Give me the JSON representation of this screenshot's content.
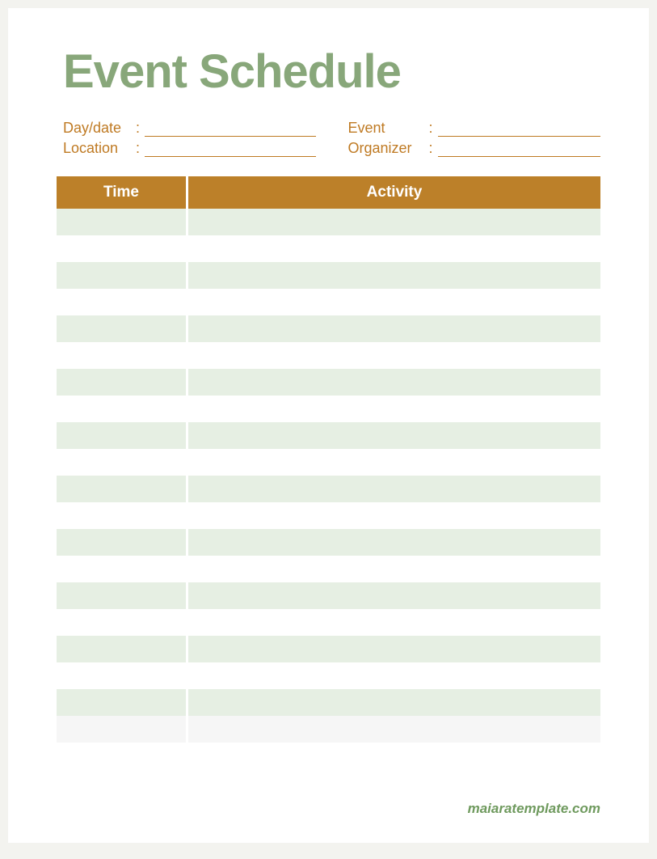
{
  "title": "Event Schedule",
  "meta": {
    "day_date_label": "Day/date",
    "location_label": "Location",
    "event_label": "Event",
    "organizer_label": "Organizer",
    "day_date_value": "",
    "location_value": "",
    "event_value": "",
    "organizer_value": ""
  },
  "table": {
    "header_time": "Time",
    "header_activity": "Activity",
    "rows": [
      {
        "time": "",
        "activity": ""
      },
      {
        "time": "",
        "activity": ""
      },
      {
        "time": "",
        "activity": ""
      },
      {
        "time": "",
        "activity": ""
      },
      {
        "time": "",
        "activity": ""
      },
      {
        "time": "",
        "activity": ""
      },
      {
        "time": "",
        "activity": ""
      },
      {
        "time": "",
        "activity": ""
      },
      {
        "time": "",
        "activity": ""
      },
      {
        "time": "",
        "activity": ""
      },
      {
        "time": "",
        "activity": ""
      },
      {
        "time": "",
        "activity": ""
      },
      {
        "time": "",
        "activity": ""
      },
      {
        "time": "",
        "activity": ""
      },
      {
        "time": "",
        "activity": ""
      },
      {
        "time": "",
        "activity": ""
      },
      {
        "time": "",
        "activity": ""
      },
      {
        "time": "",
        "activity": ""
      },
      {
        "time": "",
        "activity": ""
      },
      {
        "time": "",
        "activity": ""
      }
    ]
  },
  "footer": "maiaratemplate.com"
}
